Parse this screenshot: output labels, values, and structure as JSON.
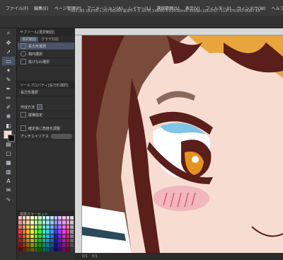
{
  "app": {
    "menu": [
      "ファイル(F)",
      "編集(E)",
      "ページ管理(P)",
      "アニメーション(A)",
      "レイヤー(L)",
      "選択範囲(S)",
      "表示(V)",
      "フィルター(I)",
      "ウィンドウ(W)",
      "ヘルプ(H)"
    ],
    "doc_info": "022 (B5 182.00 x 257.00mm 製本サイズ A5 判 148.00 x 210.00mm 350dpi 200.0%) - CLIP STUDIO PAINT EX"
  },
  "tool_panel": {
    "tabs": [
      "サブツール[選択範囲]",
      "選択範囲",
      "グラデ対応"
    ],
    "items": [
      "長方形選択",
      "楕円選択",
      "投げなわ選択"
    ],
    "property_tab": "ツールプロパティ[長方形選択]",
    "property_title": "長方形選択",
    "rows": [
      "作成方法",
      "縦横指定",
      "確定後に角度を調整",
      "アンチエイリアス"
    ]
  },
  "palette_panel": {
    "title": "標準カラーセット"
  },
  "status": {
    "items": [
      "0/1",
      "0/1"
    ]
  },
  "colors": {
    "selected": "#4a5468",
    "skin": "#f7dcd2",
    "hair_dark": "#5a1f1a",
    "hair_mid": "#7a4a3a",
    "hair_light": "#e8a53b",
    "eye_blue": "#7ec5e8",
    "eye_orange": "#e8921e",
    "blush": "#f0b7bd"
  }
}
